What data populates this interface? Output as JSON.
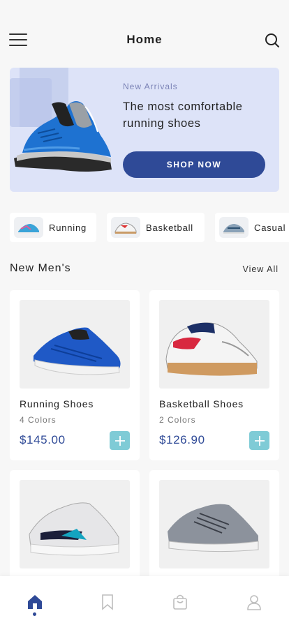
{
  "header": {
    "title": "Home",
    "menu_icon": "hamburger-menu-icon",
    "search_icon": "search-icon"
  },
  "banner": {
    "tag": "New Arrivals",
    "headline": "The most comfortable running shoes",
    "cta_label": "SHOP NOW",
    "bg_color": "#dde3f8",
    "cta_color": "#2f4a97"
  },
  "categories": [
    {
      "label": "Running"
    },
    {
      "label": "Basketball"
    },
    {
      "label": "Casual"
    }
  ],
  "section": {
    "title": "New Men's",
    "view_all": "View All"
  },
  "products": [
    {
      "name": "Running Shoes",
      "colors": "4 Colors",
      "price": "$145.00"
    },
    {
      "name": "Basketball Shoes",
      "colors": "2 Colors",
      "price": "$126.90"
    },
    {
      "name": "",
      "colors": "",
      "price": ""
    },
    {
      "name": "",
      "colors": "",
      "price": ""
    }
  ],
  "bottom_nav": [
    {
      "icon": "home-icon",
      "active": true
    },
    {
      "icon": "bookmark-icon",
      "active": false
    },
    {
      "icon": "shopping-bag-icon",
      "active": false
    },
    {
      "icon": "profile-icon",
      "active": false
    }
  ],
  "colors": {
    "accent": "#2f4a97",
    "add_button": "#7fcbd6",
    "background": "#f7f7f7"
  }
}
